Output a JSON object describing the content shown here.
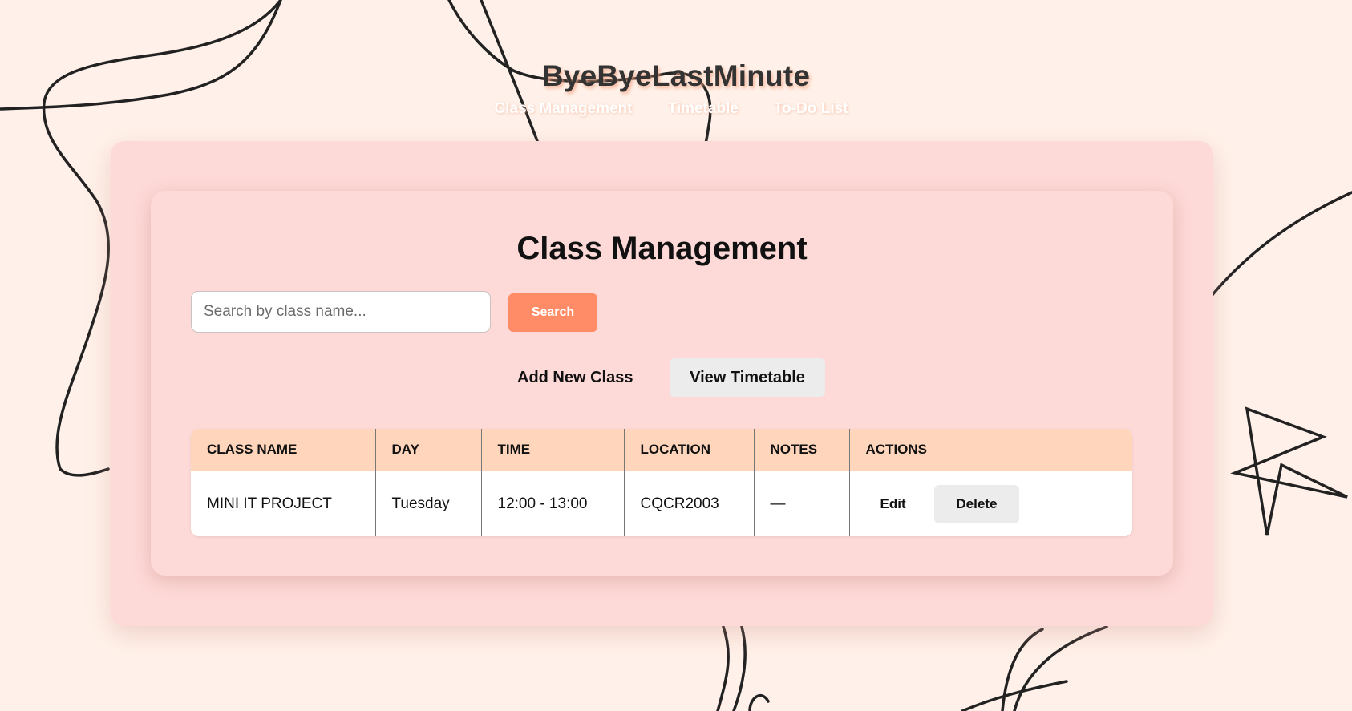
{
  "app": {
    "title": "ByeByeLastMinute"
  },
  "nav": {
    "items": [
      {
        "label": "Class Management"
      },
      {
        "label": "Timetable"
      },
      {
        "label": "To-Do List"
      }
    ]
  },
  "main": {
    "heading": "Class Management",
    "search": {
      "placeholder": "Search by class name...",
      "value": "",
      "button_label": "Search"
    },
    "add_class_label": "Add New Class",
    "view_timetable_label": "View Timetable"
  },
  "table": {
    "headers": [
      "CLASS NAME",
      "DAY",
      "TIME",
      "LOCATION",
      "NOTES",
      "ACTIONS"
    ],
    "rows": [
      {
        "class_name": "MINI IT PROJECT",
        "day": "Tuesday",
        "time": "12:00 - 13:00",
        "location": "CQCR2003",
        "notes": "—",
        "edit_label": "Edit",
        "delete_label": "Delete"
      }
    ]
  },
  "colors": {
    "background": "#fff1e9",
    "panel": "#fdd9d7",
    "accent": "#ff8c66",
    "table_header": "#ffd6bb",
    "secondary_button": "#ececec"
  }
}
